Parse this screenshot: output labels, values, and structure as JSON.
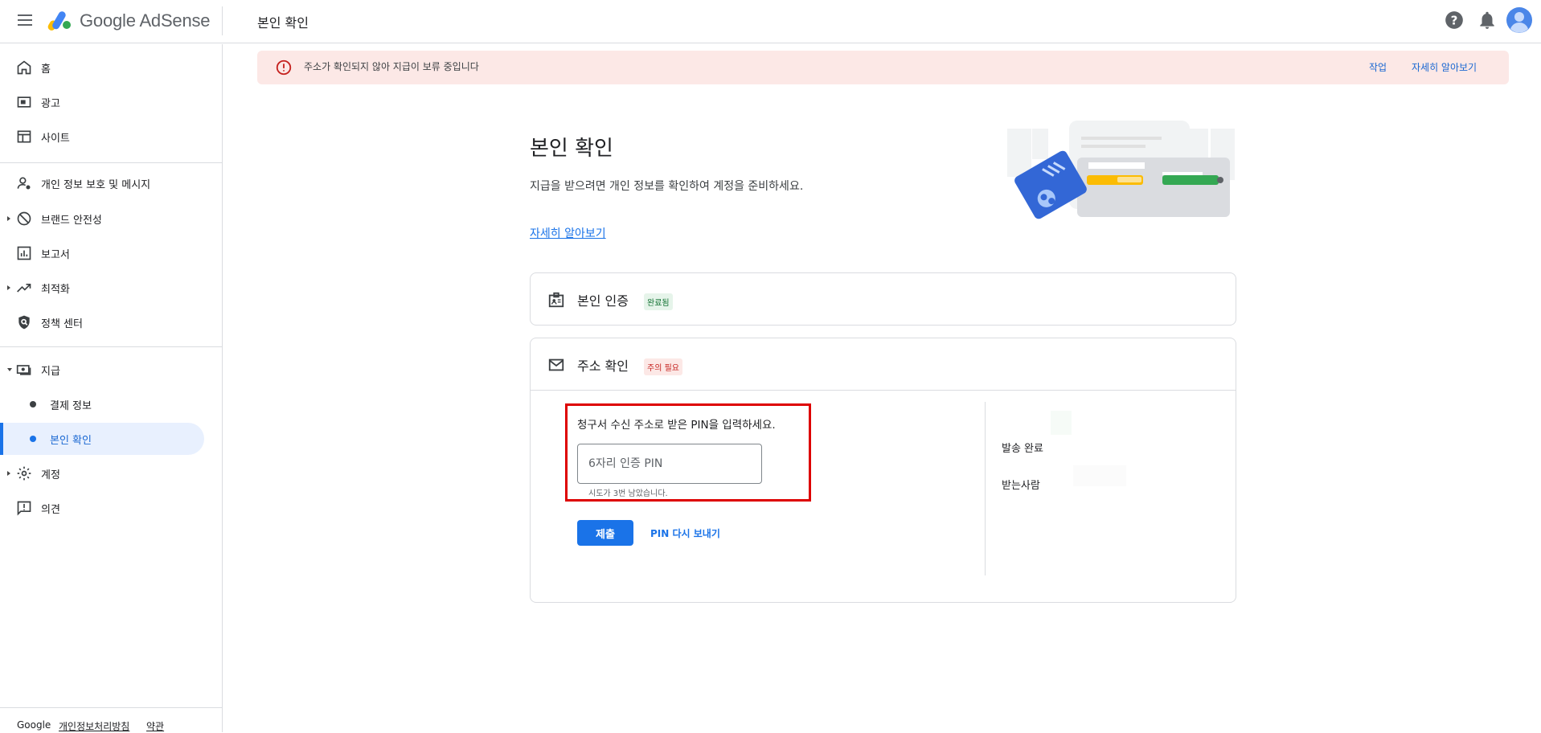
{
  "header": {
    "brand": "Google AdSense",
    "page_title": "본인 확인",
    "icons": [
      "menu-icon",
      "help-icon",
      "notifications-icon",
      "account-avatar-icon"
    ]
  },
  "sidebar": {
    "items": [
      {
        "label": "홈",
        "icon": "home-icon"
      },
      {
        "label": "광고",
        "icon": "ads-icon"
      },
      {
        "label": "사이트",
        "icon": "sites-icon"
      },
      {
        "label": "개인 정보 보호 및 메시지",
        "icon": "privacy-icon"
      },
      {
        "label": "브랜드 안전성",
        "icon": "block-icon"
      },
      {
        "label": "보고서",
        "icon": "reports-icon"
      },
      {
        "label": "최적화",
        "icon": "trending-icon"
      },
      {
        "label": "정책 센터",
        "icon": "policy-shield-icon"
      },
      {
        "label": "지급",
        "icon": "payments-icon"
      },
      {
        "label": "결제 정보"
      },
      {
        "label": "본인 확인"
      },
      {
        "label": "계정",
        "icon": "settings-icon"
      },
      {
        "label": "의견",
        "icon": "feedback-icon"
      }
    ],
    "footer": {
      "google": "Google",
      "privacy": "개인정보처리방침",
      "terms": "약관"
    }
  },
  "alert": {
    "message": "주소가 확인되지 않아 지급이 보류 중입니다",
    "action": "작업",
    "learn_more": "자세히 알아보기",
    "color": "#fce8e6"
  },
  "main": {
    "title": "본인 확인",
    "description": "지급을 받으려면 개인 정보를 확인하여 계정을 준비하세요.",
    "learn_more": "자세히 알아보기"
  },
  "identity_card": {
    "title": "본인 인증",
    "badge": "완료됨"
  },
  "address_card": {
    "title": "주소 확인",
    "badge": "주의 필요",
    "pin_prompt": "청구서 수신 주소로 받은 PIN을 입력하세요.",
    "pin_placeholder": "6자리 인증 PIN",
    "attempts_hint": "시도가 3번 남았습니다.",
    "submit": "제출",
    "resend": "PIN 다시 보내기",
    "sent_status": "발송 완료",
    "recipient": "받는사람"
  },
  "colors": {
    "accent": "#1a73e8",
    "success": "#137333",
    "danger": "#c5221f",
    "highlight": "#dd0000"
  }
}
